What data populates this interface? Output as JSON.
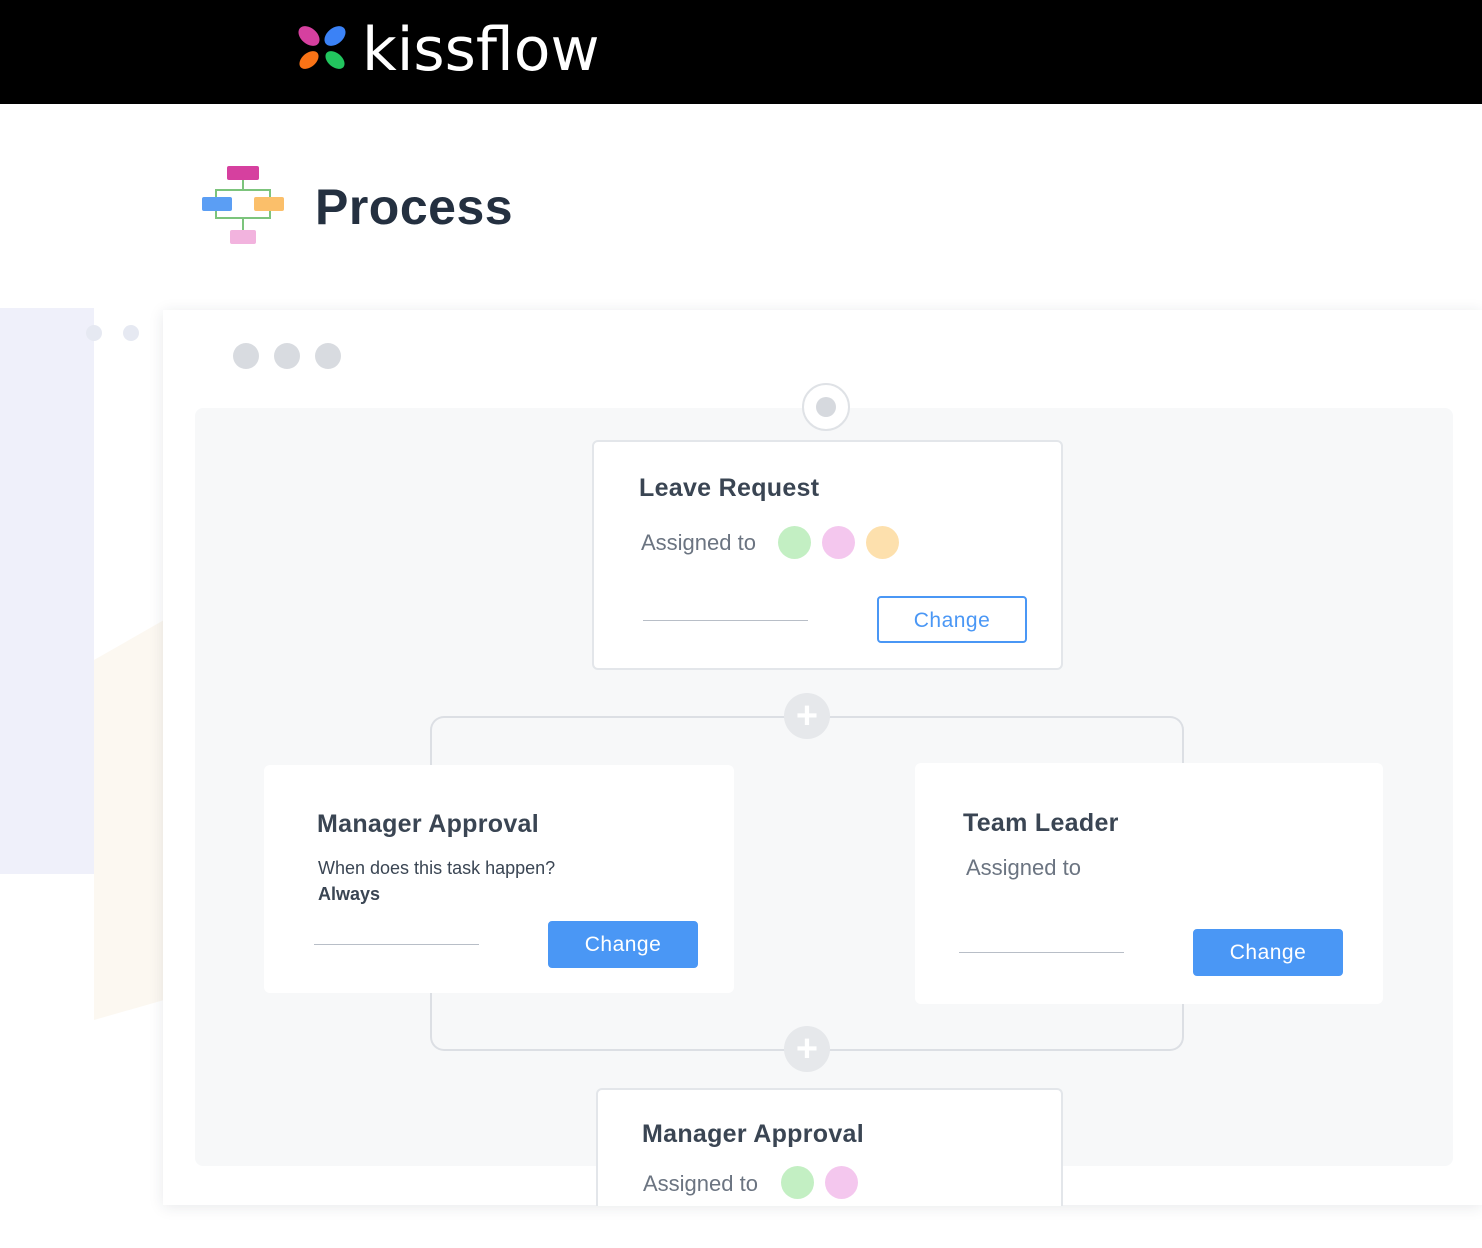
{
  "brand": {
    "name": "kissflow",
    "petal_colors": [
      "#d6409f",
      "#3b82f6",
      "#f97316",
      "#22c55e"
    ]
  },
  "page": {
    "title": "Process"
  },
  "flow": {
    "first_step": {
      "title": "Leave Request",
      "assigned_label": "Assigned to",
      "assignee_colors": [
        "#c3efc3",
        "#f4c7ee",
        "#fde0ad"
      ],
      "button_label": "Change"
    },
    "branch_left": {
      "title": "Manager Approval",
      "question": "When does this task happen?",
      "answer": "Always",
      "button_label": "Change"
    },
    "branch_right": {
      "title": "Team Leader",
      "assigned_label": "Assigned to",
      "button_label": "Change"
    },
    "last_step": {
      "title": "Manager Approval",
      "assigned_label": "Assigned to",
      "assignee_colors": [
        "#c3efc3",
        "#f4c7ee"
      ]
    }
  },
  "colors": {
    "accent": "#4a97f5",
    "topbar": "#000000"
  }
}
